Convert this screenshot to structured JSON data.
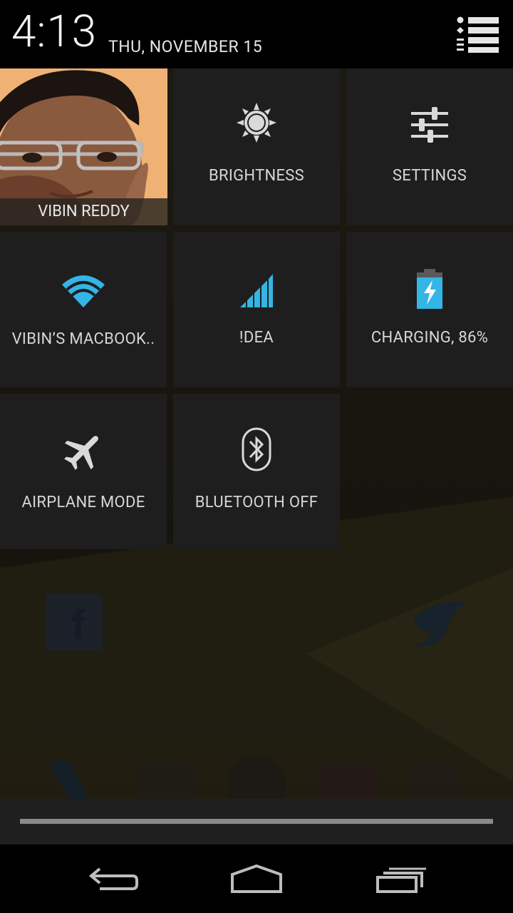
{
  "status": {
    "time": "4:13",
    "date": "THU, NOVEMBER 15"
  },
  "tiles": {
    "user": "VIBIN REDDY",
    "brightness": "BRIGHTNESS",
    "settings": "SETTINGS",
    "wifi": "VIBIN’S MACBOOK..",
    "signal": "!DEA",
    "battery": "CHARGING, 86%",
    "airplane": "AIRPLANE MODE",
    "bluetooth": "BLUETOOTH OFF"
  },
  "colors": {
    "accent": "#33b5e5",
    "tile_bg": "#1e1e1e",
    "icon_gray": "#d9d9d9"
  },
  "icons": {
    "header": "notifications-list-icon",
    "brightness": "sun-icon",
    "settings": "sliders-icon",
    "wifi": "wifi-icon",
    "signal": "signal-bars-icon",
    "battery": "battery-charging-icon",
    "airplane": "airplane-icon",
    "bluetooth": "bluetooth-icon",
    "nav": [
      "back-icon",
      "home-icon",
      "recents-icon"
    ]
  }
}
